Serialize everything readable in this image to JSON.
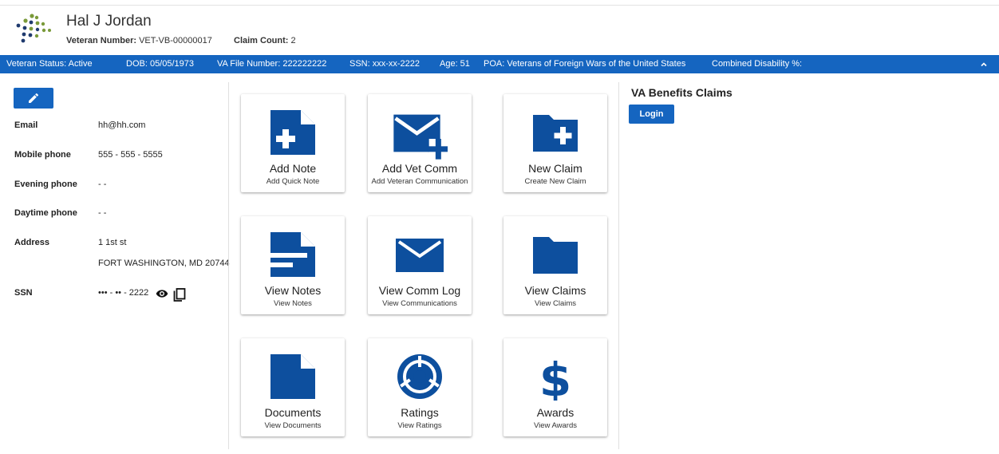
{
  "header": {
    "name": "Hal J Jordan",
    "veteran_number_label": "Veteran Number:",
    "veteran_number": "VET-VB-00000017",
    "claim_count_label": "Claim Count:",
    "claim_count": "2"
  },
  "status_bar": {
    "veteran_status": "Veteran Status: Active",
    "dob": "DOB: 05/05/1973",
    "va_file_number": "VA File Number: 222222222",
    "ssn": "SSN: xxx-xx-2222",
    "age": "Age: 51",
    "poa": "POA: Veterans of Foreign Wars of the United States",
    "combined_disability": "Combined Disability %:",
    "collapse_icon": "chevron-up-icon"
  },
  "contact": {
    "email_label": "Email",
    "email": "hh@hh.com",
    "mobile_label": "Mobile phone",
    "mobile": "555 - 555 - 5555",
    "evening_label": "Evening phone",
    "evening": "- -",
    "daytime_label": "Daytime phone",
    "daytime": "- -",
    "address_label": "Address",
    "address_line1": "1 1st st",
    "address_line2": "FORT WASHINGTON, MD 20744",
    "ssn_label": "SSN",
    "ssn_masked": "••• - •• - 2222"
  },
  "tiles": [
    {
      "title": "Add Note",
      "subtitle": "Add Quick Note",
      "icon": "note-add-icon"
    },
    {
      "title": "Add Vet Comm",
      "subtitle": "Add Veteran Communication",
      "icon": "mail-add-icon"
    },
    {
      "title": "New Claim",
      "subtitle": "Create New Claim",
      "icon": "folder-add-icon"
    },
    {
      "title": "View Notes",
      "subtitle": "View Notes",
      "icon": "note-icon"
    },
    {
      "title": "View Comm Log",
      "subtitle": "View Communications",
      "icon": "mail-icon"
    },
    {
      "title": "View Claims",
      "subtitle": "View Claims",
      "icon": "folder-icon"
    },
    {
      "title": "Documents",
      "subtitle": "View Documents",
      "icon": "document-icon"
    },
    {
      "title": "Ratings",
      "subtitle": "View Ratings",
      "icon": "ratings-icon"
    },
    {
      "title": "Awards",
      "subtitle": "View Awards",
      "icon": "dollar-icon"
    }
  ],
  "claims_panel": {
    "title": "VA Benefits Claims",
    "login_label": "Login"
  },
  "colors": {
    "primary": "#1565c0",
    "icon_blue": "#0d4f9e",
    "logo_green": "#7a9a3a",
    "logo_navy": "#1f3a6e"
  }
}
